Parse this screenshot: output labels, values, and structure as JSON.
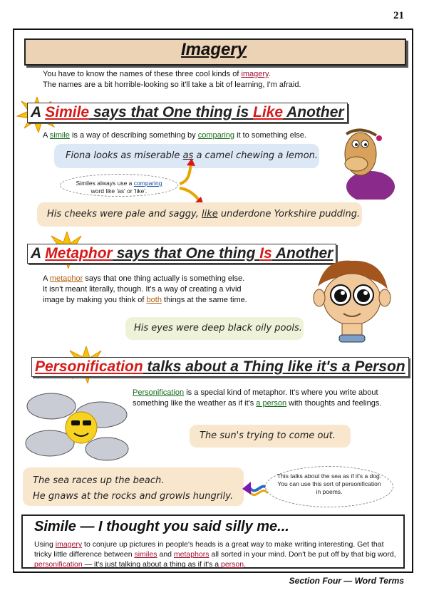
{
  "page_number": "21",
  "title": "Imagery",
  "intro": {
    "line1_pre": "You have to know the names of these three cool kinds of ",
    "line1_link": "imagery",
    "line1_post": ".",
    "line2": "The names are a bit horrible-looking so it'll take a bit of learning, I'm afraid."
  },
  "simile": {
    "heading_pre": "A ",
    "heading_word": "Simile",
    "heading_mid": " says that One thing is ",
    "heading_word2": "Like",
    "heading_post": " Another",
    "desc_pre": "A ",
    "desc_link1": "simile",
    "desc_mid": " is a way of describing something by ",
    "desc_link2": "comparing",
    "desc_post": " it to something else.",
    "example1_pre": "Fiona looks as miserable ",
    "example1_link": "as",
    "example1_post": " a camel chewing a lemon.",
    "note_pre": "Similes always use a ",
    "note_link": "comparing",
    "note_post": "word like 'as' or 'like'.",
    "example2_pre": "His cheeks were pale and saggy, ",
    "example2_link": "like",
    "example2_post": " underdone Yorkshire pudding."
  },
  "metaphor": {
    "heading_pre": "A ",
    "heading_word": "Metaphor",
    "heading_mid": " says that One thing ",
    "heading_word2": "Is",
    "heading_post": " Another",
    "desc_l1_pre": "A ",
    "desc_l1_link": "metaphor",
    "desc_l1_post": " says that one thing actually is something else.",
    "desc_l2": "It isn't meant literally, though.  It's a way of creating a vivid",
    "desc_l3_pre": "image by making you think of ",
    "desc_l3_link": "both",
    "desc_l3_post": " things at the same time.",
    "example": "His eyes were deep black oily pools."
  },
  "personification": {
    "heading_word": "Personification",
    "heading_post": " talks about a Thing like it's a Person",
    "desc_l1_link": "Personification",
    "desc_l1_post": " is a special kind of metaphor.  It's where you write about",
    "desc_l2_pre": "something like the weather as if it's ",
    "desc_l2_link": "a person",
    "desc_l2_post": " with thoughts and feelings.",
    "example1": "The sun's trying to come out.",
    "example2_l1": "The sea races up the beach.",
    "example2_l2": "He gnaws at the rocks and growls hungrily.",
    "note": "This talks about the sea as if it's a dog.  You can use this sort of personification in poems."
  },
  "summary": {
    "title": "Simile — I thought you said silly me...",
    "t1": "Using ",
    "t2": "imagery",
    "t3": " to conjure up pictures in people's heads is a great way to make writing interesting. Get that tricky little difference between ",
    "t4": "similes",
    "t5": " and ",
    "t6": "metaphors",
    "t7": " all sorted in your mind.  Don't be put off by that big word, ",
    "t8": "personification",
    "t9": " — it's just talking about a thing as if it's a ",
    "t10": "person",
    "t11": "."
  },
  "footer": "Section Four — Word Terms",
  "colors": {
    "accent_red": "#d61a1a",
    "title_bg": "#ecd3b5",
    "blue_box": "#dde8f6",
    "tan_box": "#f8e7cd",
    "green_box": "#eef2d8"
  }
}
